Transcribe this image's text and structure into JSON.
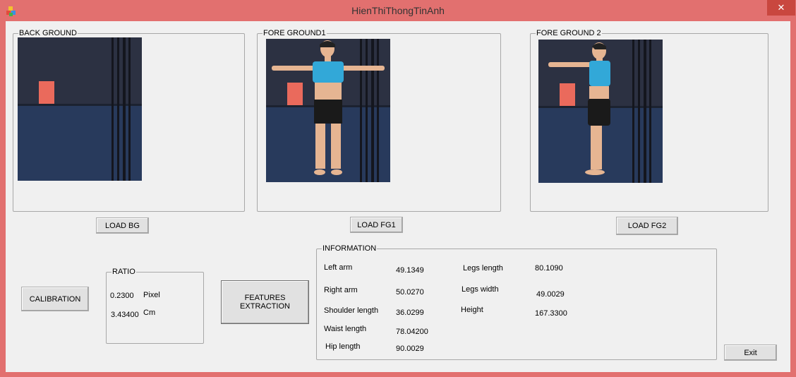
{
  "window": {
    "title": "HienThiThongTinAnh",
    "close_glyph": "✕"
  },
  "groups": {
    "background": "BACK GROUND",
    "foreground1": "FORE GROUND1",
    "foreground2": "FORE GROUND 2",
    "ratio": "RATIO",
    "information": "INFORMATION"
  },
  "buttons": {
    "load_bg": "LOAD BG",
    "load_fg1": "LOAD FG1",
    "load_fg2": "LOAD FG2",
    "calibration": "CALIBRATION",
    "features_extraction": "FEATURES EXTRACTION",
    "exit": "Exit"
  },
  "ratio": {
    "pixel_value": "0.2300",
    "pixel_unit": "Pixel",
    "cm_value": "3.43400",
    "cm_unit": "Cm"
  },
  "information": {
    "left_arm_label": "Left arm",
    "left_arm_value": "49.1349",
    "right_arm_label": "Right arm",
    "right_arm_value": "50.0270",
    "shoulder_label": "Shoulder length",
    "shoulder_value": "36.0299",
    "waist_label": "Waist length",
    "waist_value": "78.04200",
    "hip_label": "Hip length",
    "hip_value": "90.0029",
    "legs_length_label": "Legs length",
    "legs_length_value": "80.1090",
    "legs_width_label": "Legs width",
    "legs_width_value": "49.0029",
    "height_label": "Height",
    "height_value": "167.3300"
  },
  "colors": {
    "titlebar": "#e2706f",
    "close_button": "#c9473f",
    "client_bg": "#f0f0f0",
    "backdrop": "#2c3142",
    "shirt": "#32a8d8",
    "shorts": "#1a1a1a",
    "skin": "#e6b592",
    "card": "#ea6a5c"
  }
}
